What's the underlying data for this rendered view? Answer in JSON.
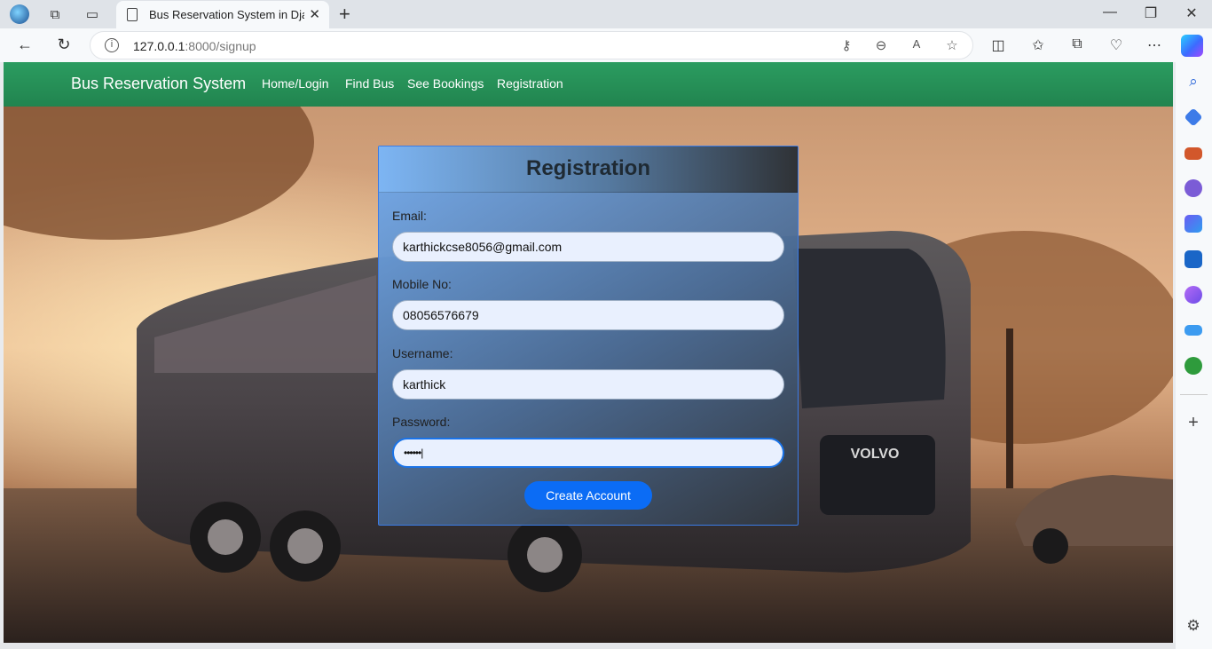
{
  "browser": {
    "tab_title": "Bus Reservation System in Djang",
    "tab_close": "✕",
    "new_tab": "+",
    "url_host": "127.0.0.1",
    "url_rest": ":8000/signup",
    "window": {
      "minimize": "—",
      "restore": "❐",
      "close": "✕"
    }
  },
  "navbar": {
    "brand": "Bus Reservation System",
    "links": [
      "Home/Login",
      "Find Bus",
      "See Bookings",
      "Registration"
    ],
    "color": "#249155"
  },
  "form": {
    "title": "Registration",
    "fields": [
      {
        "label": "Email:",
        "value": "karthickcse8056@gmail.com"
      },
      {
        "label": "Mobile No:",
        "value": "08056576679"
      },
      {
        "label": "Username:",
        "value": "karthick"
      },
      {
        "label": "Password:",
        "value": "••••••|"
      }
    ],
    "submit": "Create Account",
    "accent": "#0b6cf5"
  },
  "background": {
    "bus_badge": "VOLVO"
  }
}
